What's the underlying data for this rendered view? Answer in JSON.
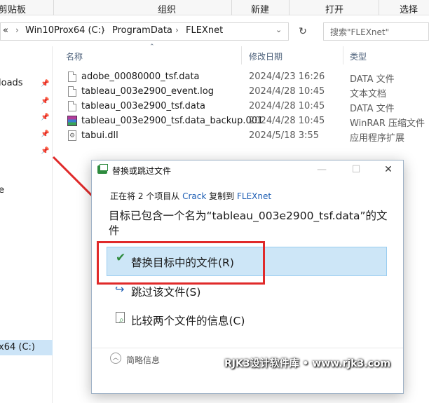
{
  "ribbon": {
    "groups": [
      "剪贴板",
      "组织",
      "新建",
      "打开",
      "选择"
    ]
  },
  "address": {
    "chevron": "«",
    "crumbs": [
      "Win10Prox64 (C:)",
      "ProgramData",
      "FLEXnet"
    ],
    "search_placeholder": "搜索\"FLEXnet\""
  },
  "nav": {
    "items": [
      "loads",
      "e",
      "x64 (C:)"
    ]
  },
  "columns": {
    "name": "名称",
    "date": "修改日期",
    "type": "类型"
  },
  "files": [
    {
      "name": "adobe_00080000_tsf.data",
      "date": "2024/4/23 16:26",
      "type": "DATA 文件",
      "icon": "file-icon"
    },
    {
      "name": "tableau_003e2900_event.log",
      "date": "2024/4/28 10:45",
      "type": "文本文档",
      "icon": "text-file-icon"
    },
    {
      "name": "tableau_003e2900_tsf.data",
      "date": "2024/4/28 10:45",
      "type": "DATA 文件",
      "icon": "file-icon"
    },
    {
      "name": "tableau_003e2900_tsf.data_backup.001",
      "date": "2024/4/28 10:45",
      "type": "WinRAR 压缩文件",
      "icon": "winrar-icon"
    },
    {
      "name": "tabui.dll",
      "date": "2024/5/18 3:55",
      "type": "应用程序扩展",
      "icon": "dll-icon"
    }
  ],
  "dialog": {
    "title": "替换或跳过文件",
    "progress_prefix": "正在将 2 个项目从",
    "source": "Crack",
    "copy_to": "复制到",
    "destination": "FLEXnet",
    "message": "目标已包含一个名为“tableau_003e2900_tsf.data”的文件",
    "option_replace": "替换目标中的文件(R)",
    "option_skip": "跳过该文件(S)",
    "option_compare": "比较两个文件的信息(C)",
    "more_details": "简略信息"
  },
  "watermark": "RJK3设计软件库 • www.rjk3.com",
  "colors": {
    "annotation": "#e02a2a",
    "selection": "#cde6f7",
    "link": "#1f5fb4"
  }
}
